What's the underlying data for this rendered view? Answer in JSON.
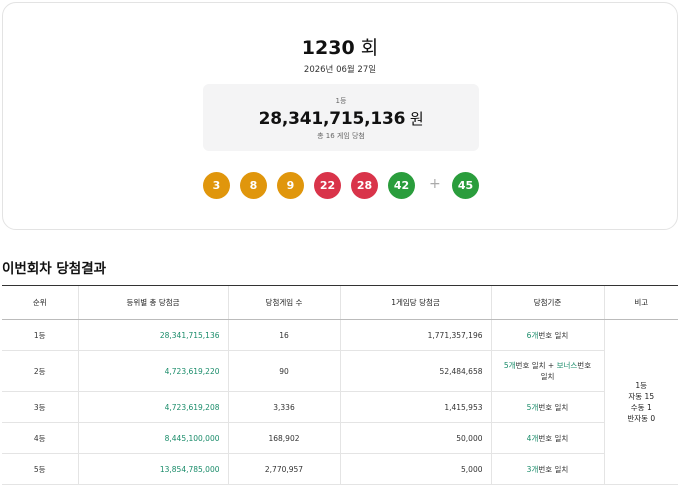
{
  "draw": {
    "round_number": "1230",
    "round_suffix": " 회",
    "date": "2026년 06월 27일",
    "prize_rank": "1등",
    "prize_amount": "28,341,715,136",
    "prize_unit": " 원",
    "winner_count": "총 16 게임 당첨",
    "balls": [
      {
        "num": "3",
        "color": "#e0960c"
      },
      {
        "num": "8",
        "color": "#e0960c"
      },
      {
        "num": "9",
        "color": "#e0960c"
      },
      {
        "num": "22",
        "color": "#d9344a"
      },
      {
        "num": "28",
        "color": "#d9344a"
      },
      {
        "num": "42",
        "color": "#2a9d3c"
      }
    ],
    "plus": "+",
    "bonus": {
      "num": "45",
      "color": "#2a9d3c"
    }
  },
  "results": {
    "title": "이번회차 당첨결과",
    "headers": [
      "순위",
      "등위별 총 당첨금",
      "당첨게임 수",
      "1게임당 당첨금",
      "당첨기준",
      "비고"
    ],
    "rows": [
      {
        "rank": "1등",
        "total": "28,341,715,136",
        "count": "16",
        "each": "1,771,357,196",
        "crit_pre": "",
        "crit_hl": "6개",
        "crit_post": "번호 일치",
        "crit_hl2": "",
        "crit_post2": ""
      },
      {
        "rank": "2등",
        "total": "4,723,619,220",
        "count": "90",
        "each": "52,484,658",
        "crit_pre": "",
        "crit_hl": "5개",
        "crit_post": "번호 일치 + ",
        "crit_hl2": "보너스",
        "crit_post2": "번호 일치"
      },
      {
        "rank": "3등",
        "total": "4,723,619,208",
        "count": "3,336",
        "each": "1,415,953",
        "crit_pre": "",
        "crit_hl": "5개",
        "crit_post": "번호 일치",
        "crit_hl2": "",
        "crit_post2": ""
      },
      {
        "rank": "4등",
        "total": "8,445,100,000",
        "count": "168,902",
        "each": "50,000",
        "crit_pre": "",
        "crit_hl": "4개",
        "crit_post": "번호 일치",
        "crit_hl2": "",
        "crit_post2": ""
      },
      {
        "rank": "5등",
        "total": "13,854,785,000",
        "count": "2,770,957",
        "each": "5,000",
        "crit_pre": "",
        "crit_hl": "3개",
        "crit_post": "번호 일치",
        "crit_hl2": "",
        "crit_post2": ""
      }
    ],
    "note": [
      "1등",
      "자동 15",
      "수동 1",
      "반자동 0"
    ]
  }
}
